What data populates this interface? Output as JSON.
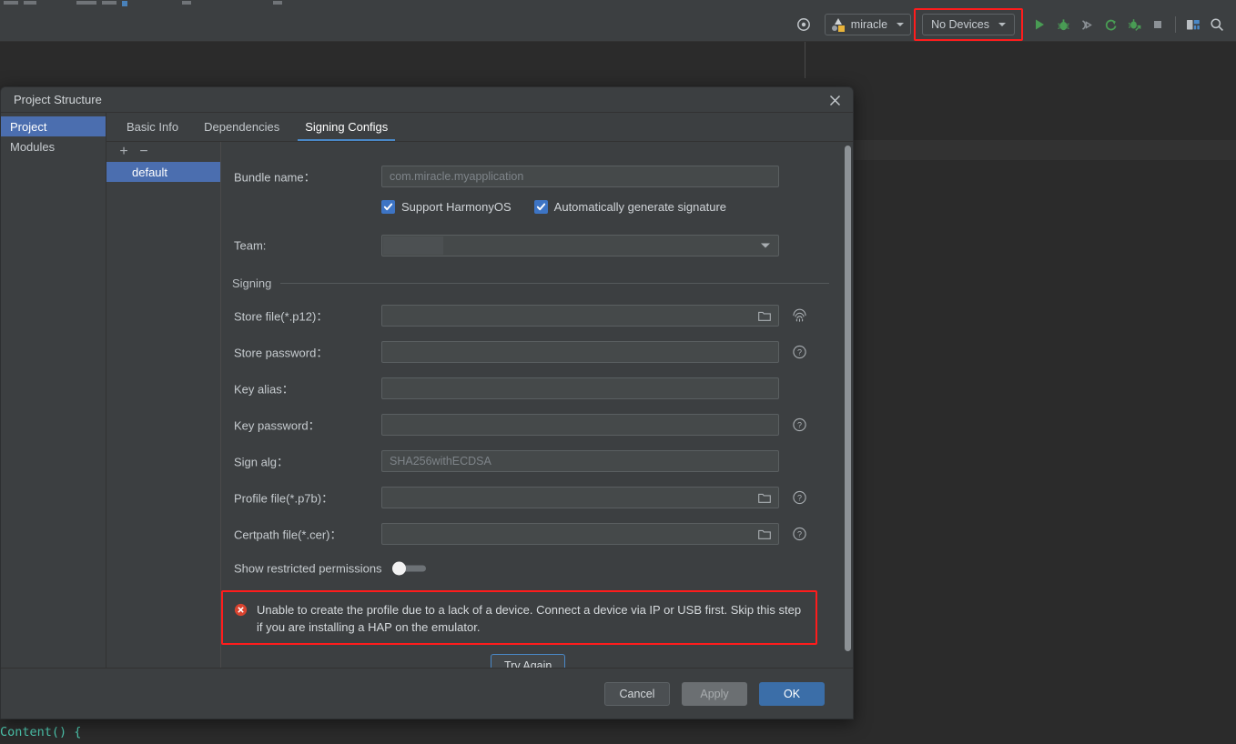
{
  "ide": {
    "toolbar": {
      "target_selector": {
        "label": "miracle",
        "icon": "module-icon"
      },
      "device_selector": {
        "label": "No Devices",
        "highlighted": true,
        "highlight_color": "#ff1c1c"
      },
      "icons": [
        {
          "name": "settings-target-icon",
          "glyph": "gear"
        },
        {
          "name": "run-icon",
          "glyph": "play",
          "color": "#499c54"
        },
        {
          "name": "debug-icon",
          "glyph": "bug",
          "color": "#499c54"
        },
        {
          "name": "attach-debugger-icon",
          "glyph": "bug-attach",
          "color": "#9aa0a6"
        },
        {
          "name": "rerun-icon",
          "glyph": "refresh-arrow",
          "color": "#499c54"
        },
        {
          "name": "profile-icon",
          "glyph": "bug-arrow",
          "color": "#499c54"
        },
        {
          "name": "stop-icon",
          "glyph": "square",
          "color": "#9aa0a6"
        },
        {
          "name": "device-manager-icon",
          "glyph": "device",
          "color": "#4a88c7"
        },
        {
          "name": "search-icon",
          "glyph": "magnifier",
          "color": "#c0c5c9"
        }
      ]
    },
    "editor": {
      "code_line": "Content() {"
    }
  },
  "dialog": {
    "title": "Project Structure",
    "close_label": "✕",
    "nav": {
      "items": [
        {
          "label": "Project",
          "selected": true
        },
        {
          "label": "Modules",
          "selected": false
        }
      ]
    },
    "tabs": [
      {
        "label": "Basic Info",
        "active": false
      },
      {
        "label": "Dependencies",
        "active": false
      },
      {
        "label": "Signing Configs",
        "active": true
      }
    ],
    "config_list": {
      "add_label": "+",
      "remove_label": "−",
      "items": [
        {
          "label": "default",
          "selected": true
        }
      ]
    },
    "form": {
      "bundle_name": {
        "label": "Bundle name：",
        "value": "",
        "placeholder": "com.miracle.myapplication"
      },
      "checkboxes": [
        {
          "label": "Support HarmonyOS",
          "checked": true
        },
        {
          "label": "Automatically generate signature",
          "checked": true
        }
      ],
      "team": {
        "label": "Team:",
        "value": "",
        "placeholder": ""
      },
      "section_signing": "Signing",
      "store_file": {
        "label": "Store file(*.p12)：",
        "value": "",
        "placeholder": ""
      },
      "store_password": {
        "label": "Store password：",
        "value": "",
        "placeholder": ""
      },
      "key_alias": {
        "label": "Key alias：",
        "value": "",
        "placeholder": ""
      },
      "key_password": {
        "label": "Key password：",
        "value": "",
        "placeholder": ""
      },
      "sign_alg": {
        "label": "Sign alg：",
        "value": "",
        "placeholder": "SHA256withECDSA"
      },
      "profile_file": {
        "label": "Profile file(*.p7b)：",
        "value": "",
        "placeholder": ""
      },
      "certpath_file": {
        "label": "Certpath file(*.cer)：",
        "value": "",
        "placeholder": ""
      },
      "show_restricted": {
        "label": "Show restricted permissions",
        "on": false
      }
    },
    "error": {
      "icon": "error-circle-icon",
      "message": "Unable to create the profile due to a lack of a device. Connect a device via IP or USB first. Skip this step if you are installing a HAP on the emulator.",
      "highlighted": true,
      "highlight_color": "#ff1c1c",
      "action_label": "Try Again"
    },
    "footer": {
      "cancel": "Cancel",
      "apply": "Apply",
      "ok": "OK"
    }
  },
  "colors": {
    "accent_blue": "#4b6eaf",
    "tab_underline": "#4a88c7",
    "error_red": "#ff1c1c",
    "panel_bg": "#3c3f41",
    "editor_bg": "#2b2b2b"
  }
}
